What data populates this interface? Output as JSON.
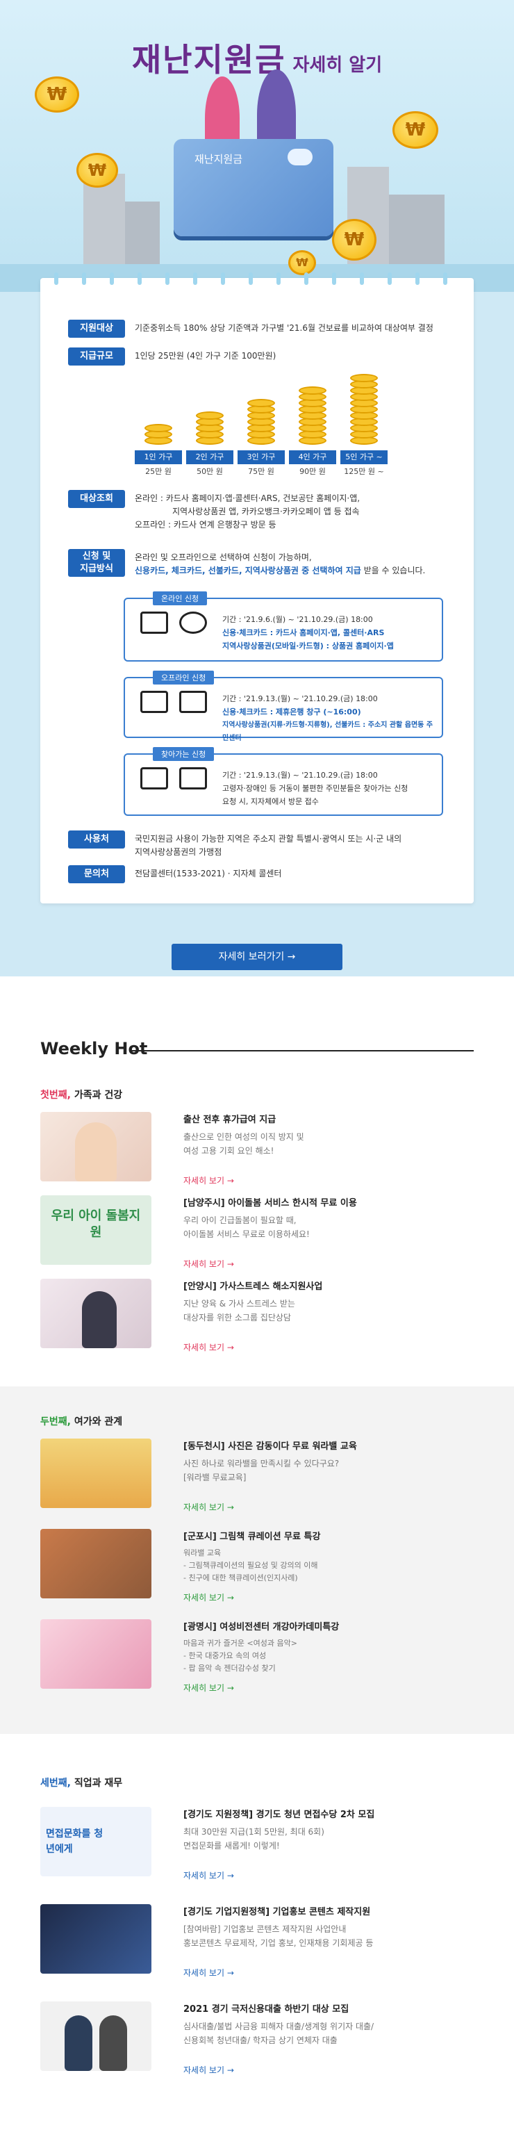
{
  "hero": {
    "title": "재난지원금",
    "subtitle": "자세히 알기",
    "card_label": "재난지원금",
    "coin_symbol": "₩"
  },
  "info": {
    "eligibility": {
      "label": "지원대상",
      "text": "기준중위소득 180% 상당 기준액과 가구별 '21.6월 건보료를 비교하여 대상여부 결정"
    },
    "amount": {
      "label": "지급규모",
      "text": "1인당 25만원 (4인 가구 기준 100만원)"
    },
    "tiers": [
      {
        "label": "1인 가구",
        "amount": "25만 원",
        "coins": 3
      },
      {
        "label": "2인 가구",
        "amount": "50만 원",
        "coins": 5
      },
      {
        "label": "3인 가구",
        "amount": "75만 원",
        "coins": 7
      },
      {
        "label": "4인 가구",
        "amount": "90만 원",
        "coins": 9
      },
      {
        "label": "5인 가구 ~",
        "amount": "125만 원 ~",
        "coins": 11
      }
    ],
    "target": {
      "label": "대상조회",
      "online": "온라인 : 카드사 홈페이지·앱·콜센터·ARS, 건보공단 홈페이지·앱,",
      "online2": "지역사랑상품권 앱, 카카오뱅크·카카오페이 앱 등 접속",
      "offline": "오프라인 : 카드사 연계 은행창구 방문 등"
    },
    "apply": {
      "label1": "신청 및",
      "label2": "지급방식",
      "text1": "온라인 및 오프라인으로 선택하여 신청이 가능하며,",
      "text2": "신용카드, 체크카드, 선불카드, 지역사랑상품권 중 선택하여 지급",
      "text3": "받을 수 있습니다."
    },
    "boxes": [
      {
        "title": "온라인 신청",
        "l1": "기간 : '21.9.6.(월) ~ '21.10.29.(금) 18:00",
        "l2": "신용·체크카드 : 카드사 홈페이지·앱, 콜센터·ARS",
        "l3": "지역사랑상품권(모바일·카드형) : 상품권 홈페이지·앱"
      },
      {
        "title": "오프라인 신청",
        "l1": "기간 : '21.9.13.(월) ~ '21.10.29.(금) 18:00",
        "l2": "신용·체크카드 : 제휴은행 창구 (~16:00)",
        "l3": "지역사랑상품권(지류·카드형·지류형), 선불카드 : 주소지 관할 읍면동 주민센터"
      },
      {
        "title": "찾아가는 신청",
        "l1": "기간 : '21.9.13.(월) ~ '21.10.29.(금) 18:00",
        "l2": "고령자·장애인 등 거동이 불편한 주민분들은 찾아가는 신청",
        "l3": "요청 시, 지자체에서 방문 접수"
      }
    ],
    "usage": {
      "label": "사용처",
      "text1": "국민지원금 사용이 가능한 지역은 주소지 관할 특별시·광역시 또는 시·군 내의",
      "text2": "지역사랑상품권의 가맹점"
    },
    "contact": {
      "label": "문의처",
      "text": "전담콜센터(1533-2021) · 지자체 콜센터"
    }
  },
  "more_button": "자세히 보러가기 →",
  "weekly": {
    "heading": "Weekly Hot",
    "sections": [
      {
        "num": "첫번째,",
        "title": "가족과 건강",
        "items": [
          {
            "title": "출산 전후 휴가급여 지급",
            "desc": "출산으로 인한 여성의 이직 방지 및\n여성 고용 기회 요인 해소!",
            "link": "자세히 보기 →",
            "thumb_text": ""
          },
          {
            "title": "[남양주시] 아이돌봄 서비스 한시적 무료 이용",
            "desc": "우리 아이 긴급돌봄이 필요할 때,\n아이돌봄 서비스 무료로 이용하세요!",
            "link": "자세히 보기 →",
            "thumb_text": "우리 아이 돌봄지원"
          },
          {
            "title": "[안양시] 가사스트레스 해소지원사업",
            "desc": "지난 양육 & 가사 스트레스 받는\n대상자를 위한 소그룹 집단상담",
            "link": "자세히 보기 →",
            "thumb_text": ""
          }
        ]
      },
      {
        "num": "두번째,",
        "title": "여가와 관계",
        "items": [
          {
            "title": "[동두천시] 사진은 감동이다 무료 워라밸 교육",
            "desc": "사진 하나로 워라밸을 만족시킬 수 있다구요?\n[워라밸 무료교육]",
            "link": "자세히 보기 →"
          },
          {
            "title": "[군포시] 그림책 큐레이션 무료 특강",
            "desc": "워라밸 교육\n- 그림책큐레이션의 필요성 및 강의의 이해\n- 친구에 대한 책큐레이션(인지사례)",
            "link": "자세히 보기 →"
          },
          {
            "title": "[광명시] 여성비전센터 개강아카데미특강",
            "desc": "마음과 귀가 즐거운 <여성과 음악>\n- 한국 대중가요 속의 여성\n- 팝 음악 속 젠더감수성 찾기",
            "link": "자세히 보기 →"
          }
        ]
      },
      {
        "num": "세번째,",
        "title": "직업과 재무",
        "items": [
          {
            "title": "[경기도 지원정책] 경기도 청년 면접수당 2차 모집",
            "desc": "최대 30만원 지급(1회 5만원, 최대 6회)\n면접문화를 새롭게! 이렇게!",
            "link": "자세히 보기 →",
            "thumb_text": "면접문화를 청년에게"
          },
          {
            "title": "[경기도 기업지원정책] 기업홍보 콘텐츠 제작지원",
            "desc": "[참여바람] 기업홍보 콘텐츠 제작지원 사업안내\n홍보콘텐츠 무료제작, 기업 홍보, 인재채용 기회제공 등",
            "link": "자세히 보기 →"
          },
          {
            "title": "2021 경기 극저신용대출 하반기 대상 모집",
            "desc": "심사대출/불법 사금융 피해자 대출/생계형 위기자 대출/\n신용회복 청년대출/ 학자금 상기 연체자 대출",
            "link": "자세히 보기 →"
          }
        ]
      }
    ]
  }
}
